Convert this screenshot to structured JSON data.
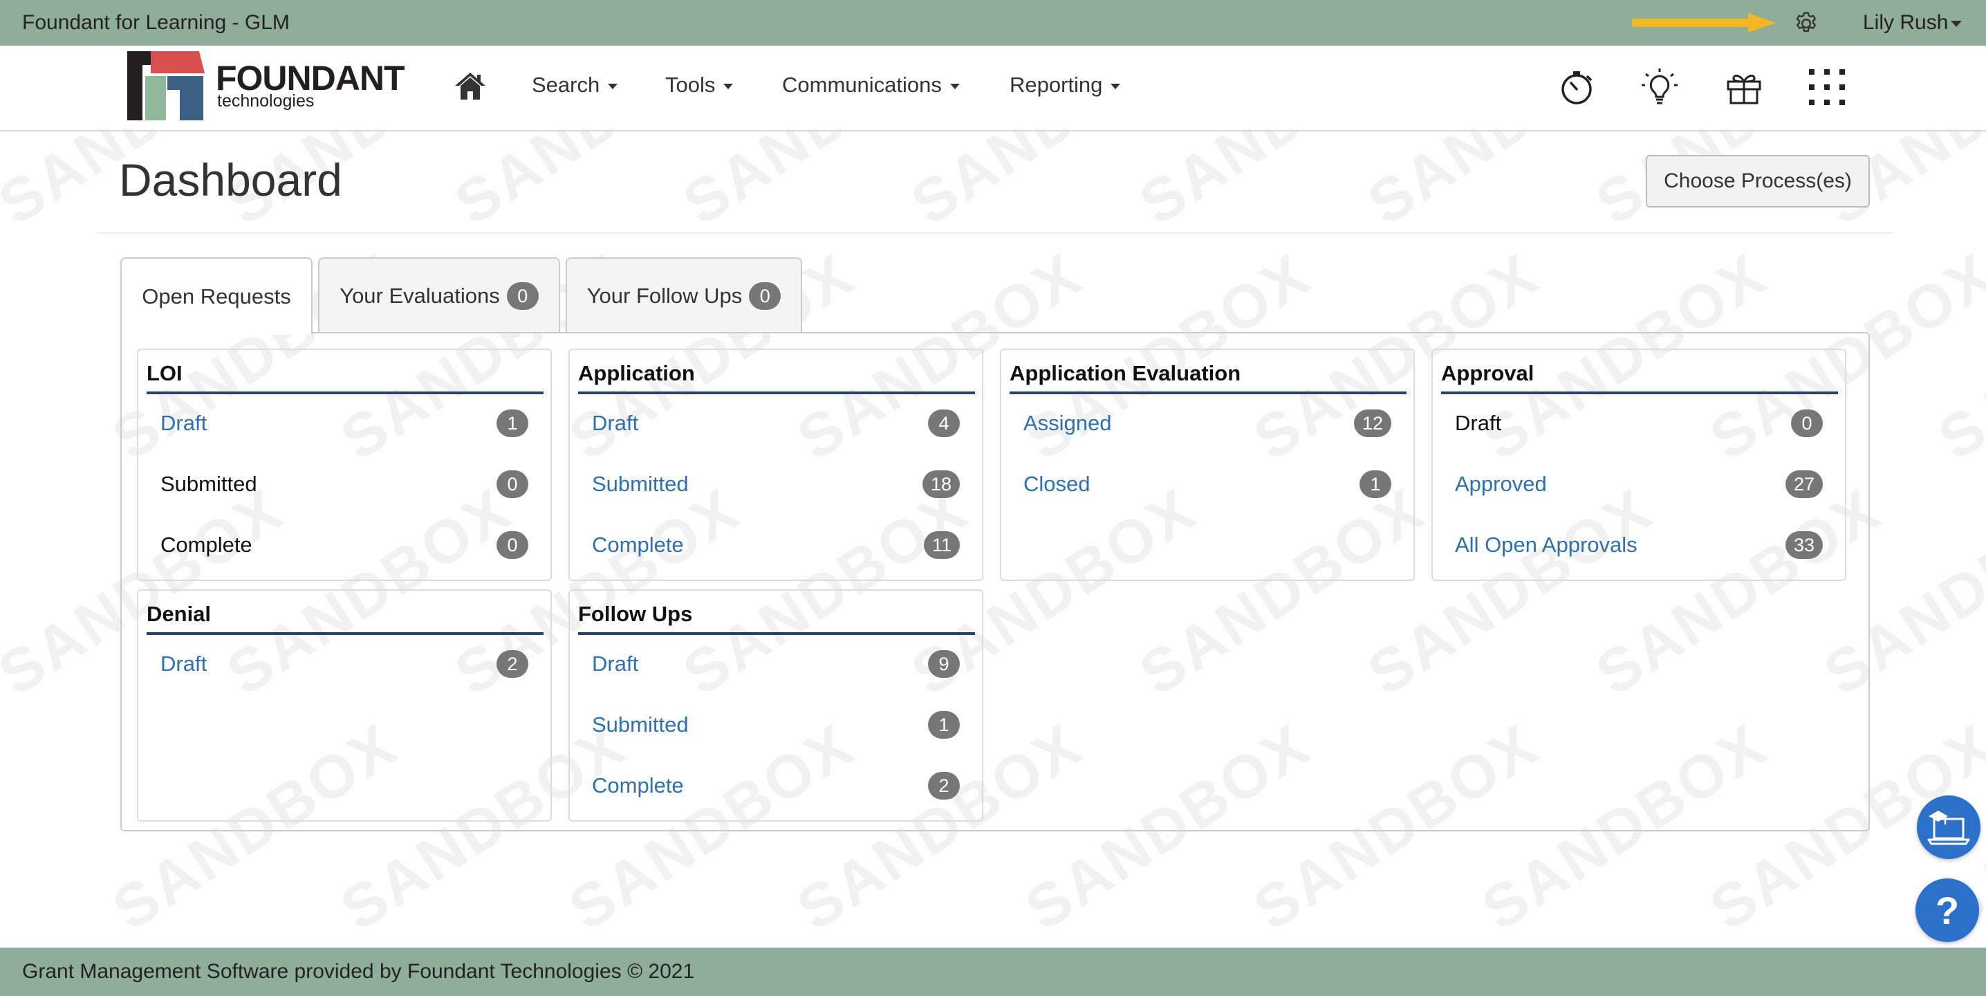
{
  "topbar": {
    "app_title": "Foundant for Learning - GLM",
    "user_name": "Lily Rush",
    "accent_color": "#8fad99",
    "arrow_color": "#f3b823"
  },
  "logo": {
    "name": "FOUNDANT",
    "subtitle": "technologies"
  },
  "nav": {
    "items": [
      {
        "label": "Search"
      },
      {
        "label": "Tools"
      },
      {
        "label": "Communications"
      },
      {
        "label": "Reporting"
      }
    ],
    "icons": [
      "timer-icon",
      "lightbulb-icon",
      "gift-icon",
      "apps-grid-icon"
    ]
  },
  "watermark_text": "SANDBOX",
  "page": {
    "title": "Dashboard",
    "choose_button": "Choose Process(es)"
  },
  "tabs": [
    {
      "label": "Open Requests",
      "count": null
    },
    {
      "label": "Your Evaluations",
      "count": "0"
    },
    {
      "label": "Your Follow Ups",
      "count": "0"
    }
  ],
  "cards": [
    {
      "title": "LOI",
      "rows": [
        {
          "label": "Draft",
          "count": "1",
          "link": true
        },
        {
          "label": "Submitted",
          "count": "0",
          "link": false
        },
        {
          "label": "Complete",
          "count": "0",
          "link": false
        }
      ]
    },
    {
      "title": "Application",
      "rows": [
        {
          "label": "Draft",
          "count": "4",
          "link": true
        },
        {
          "label": "Submitted",
          "count": "18",
          "link": true
        },
        {
          "label": "Complete",
          "count": "11",
          "link": true
        }
      ]
    },
    {
      "title": "Application Evaluation",
      "rows": [
        {
          "label": "Assigned",
          "count": "12",
          "link": true
        },
        {
          "label": "Closed",
          "count": "1",
          "link": true
        }
      ]
    },
    {
      "title": "Approval",
      "rows": [
        {
          "label": "Draft",
          "count": "0",
          "link": false
        },
        {
          "label": "Approved",
          "count": "27",
          "link": true
        },
        {
          "label": "All Open Approvals",
          "count": "33",
          "link": true
        }
      ]
    },
    {
      "title": "Denial",
      "rows": [
        {
          "label": "Draft",
          "count": "2",
          "link": true
        }
      ]
    },
    {
      "title": "Follow Ups",
      "rows": [
        {
          "label": "Draft",
          "count": "9",
          "link": true
        },
        {
          "label": "Submitted",
          "count": "1",
          "link": true
        },
        {
          "label": "Complete",
          "count": "2",
          "link": true
        }
      ]
    }
  ],
  "help_label": "?",
  "footer_text": "Grant Management Software provided by Foundant Technologies © 2021",
  "colors": {
    "link": "#2f6fad",
    "card_rule": "#25456b",
    "badge": "#777777",
    "fab": "#2b70c9"
  }
}
